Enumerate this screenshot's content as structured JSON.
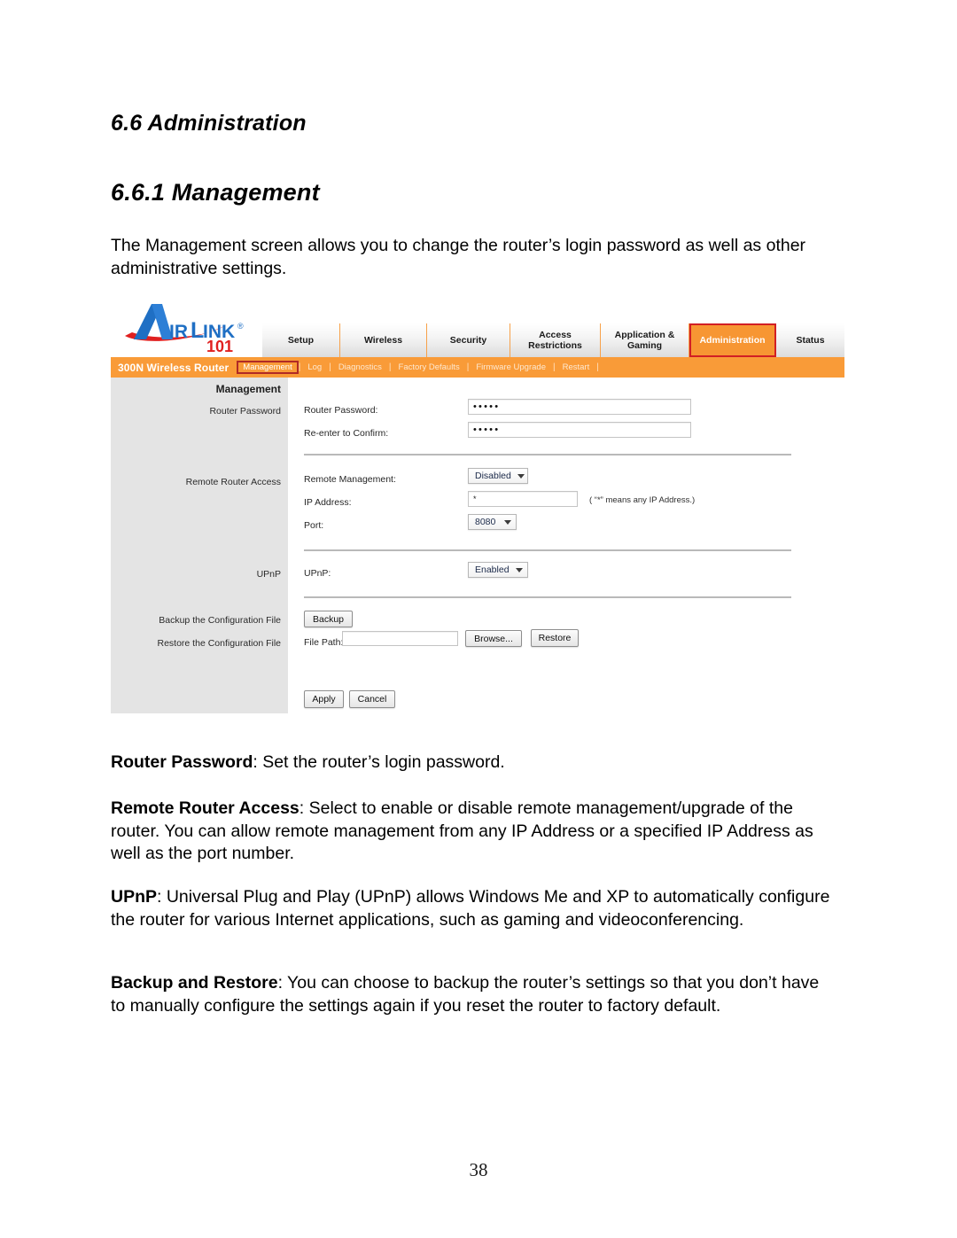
{
  "document": {
    "heading_section": "6.6 Administration",
    "heading_subsection": "6.6.1 Management",
    "intro_paragraph": "The Management screen allows you to change the router’s login password as well as other administrative settings.",
    "page_number": "38"
  },
  "descriptions": {
    "router_password": {
      "term": "Router Password",
      "text": ": Set the router’s login password."
    },
    "remote_router_access": {
      "term": "Remote Router Access",
      "text": ": Select to enable or disable remote management/upgrade of the router. You can allow remote management from any IP Address or a specified IP Address as well as the port number."
    },
    "upnp": {
      "term": "UPnP",
      "text": ": Universal Plug and Play (UPnP) allows Windows Me and XP to automatically configure the router for various Internet applications, such as gaming and videoconferencing."
    },
    "backup_and_restore": {
      "term": "Backup and Restore",
      "text": ": You can choose to backup the router’s settings so that you don’t have to manually configure the settings again if you reset the router to factory default."
    }
  },
  "router_ui": {
    "logo": {
      "brand": "AIRLINK",
      "suffix": "101",
      "registered_mark": "®",
      "brand_color": "#1f6fc4",
      "accent_color": "#e02020"
    },
    "accent_orange": "#f99b38",
    "selected_outline": "#d21f24",
    "main_tabs": [
      {
        "label": "Setup",
        "selected": false
      },
      {
        "label": "Wireless",
        "selected": false
      },
      {
        "label": "Security",
        "selected": false
      },
      {
        "label": "Access\nRestrictions",
        "selected": false
      },
      {
        "label": "Application &\nGaming",
        "selected": false
      },
      {
        "label": "Administration",
        "selected": true
      },
      {
        "label": "Status",
        "selected": false
      }
    ],
    "model_name": "300N Wireless Router",
    "sub_tabs": [
      {
        "label": "Management",
        "selected": true
      },
      {
        "label": "Log",
        "selected": false
      },
      {
        "label": "Diagnostics",
        "selected": false
      },
      {
        "label": "Factory Defaults",
        "selected": false
      },
      {
        "label": "Firmware Upgrade",
        "selected": false
      },
      {
        "label": "Restart",
        "selected": false
      }
    ],
    "left_panel": {
      "title": "Management",
      "rows": [
        "Router Password",
        "Remote Router Access",
        "UPnP",
        "Backup the Configuration File",
        "Restore the Configuration File"
      ]
    },
    "form": {
      "router_password_label": "Router Password:",
      "router_password_value": "•••••",
      "reenter_label": "Re-enter to Confirm:",
      "reenter_value": "•••••",
      "remote_management_label": "Remote Management:",
      "remote_management_value": "Disabled",
      "ip_address_label": "IP Address:",
      "ip_address_value": "*",
      "ip_address_hint": "( “*” means any IP Address.)",
      "port_label": "Port:",
      "port_value": "8080",
      "upnp_label": "UPnP:",
      "upnp_value": "Enabled",
      "backup_button": "Backup",
      "file_path_label": "File Path:",
      "file_path_value": "",
      "browse_button": "Browse...",
      "restore_button": "Restore",
      "apply_button": "Apply",
      "cancel_button": "Cancel"
    }
  }
}
